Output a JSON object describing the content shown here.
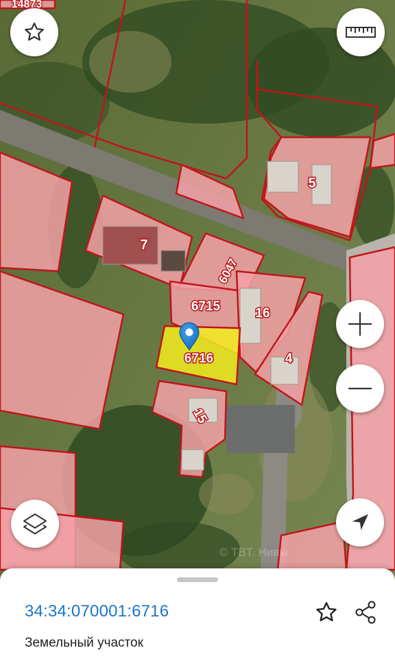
{
  "map": {
    "parcels": [
      {
        "id": "14873",
        "label": "14873"
      },
      {
        "id": "5",
        "label": "5"
      },
      {
        "id": "7",
        "label": "7"
      },
      {
        "id": "6047",
        "label": "6047"
      },
      {
        "id": "6715",
        "label": "6715"
      },
      {
        "id": "16",
        "label": "16"
      },
      {
        "id": "6716",
        "label": "6716",
        "selected": true
      },
      {
        "id": "4",
        "label": "4"
      },
      {
        "id": "15",
        "label": "15"
      }
    ],
    "watermark": "© TBT. Нивы",
    "colors": {
      "boundary": "#c1141b",
      "parcel_fill": "#f3a1a6",
      "selected_fill": "#f2ec1e",
      "pin": "#1f7fd1",
      "imagery": "#6b7a4a"
    }
  },
  "controls": {
    "favorite_icon": "star-outline-icon",
    "ruler_icon": "ruler-icon",
    "zoom_in_icon": "plus-icon",
    "zoom_out_icon": "minus-icon",
    "layers_icon": "layers-icon",
    "locate_icon": "navigation-arrow-icon"
  },
  "sheet": {
    "cadastral_number": "34:34:070001:6716",
    "object_type": "Земельный участок",
    "favorite_icon": "star-outline-icon",
    "share_icon": "share-icon"
  }
}
